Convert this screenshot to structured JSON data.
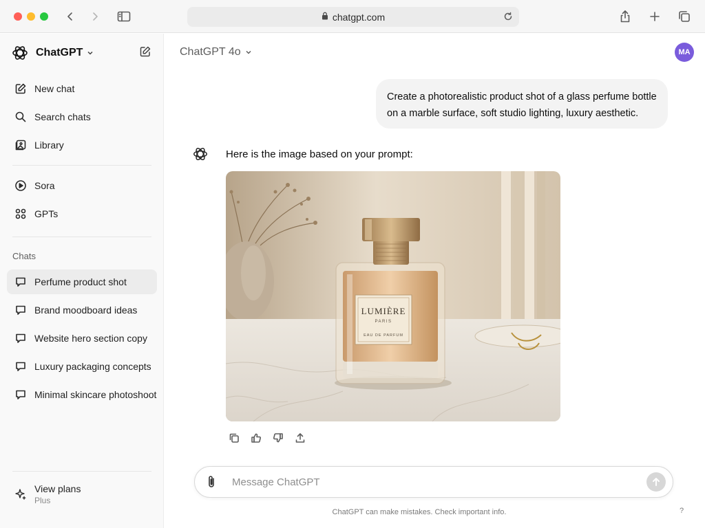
{
  "browser": {
    "url": "chatgpt.com"
  },
  "sidebar": {
    "brand": "ChatGPT",
    "nav": [
      {
        "label": "New chat",
        "icon": "new-chat-icon"
      },
      {
        "label": "Search chats",
        "icon": "search-icon"
      },
      {
        "label": "Library",
        "icon": "library-icon"
      },
      {
        "label": "Sora",
        "icon": "play-icon"
      },
      {
        "label": "GPTs",
        "icon": "grid-icon"
      }
    ],
    "section_title": "Chats",
    "chats": [
      {
        "label": "Perfume product shot",
        "active": true
      },
      {
        "label": "Brand moodboard ideas",
        "active": false
      },
      {
        "label": "Website hero section copy",
        "active": false
      },
      {
        "label": "Luxury packaging concepts",
        "active": false
      },
      {
        "label": "Minimal skincare photoshoot",
        "active": false
      }
    ],
    "plans": {
      "title": "View plans",
      "subtitle": "Plus"
    }
  },
  "header": {
    "model": "ChatGPT 4o",
    "avatar_initials": "MA",
    "avatar_color": "#7a5cdc"
  },
  "conversation": {
    "user_message": "Create a photorealistic product shot of a glass perfume bottle on a marble surface, soft studio lighting, luxury aesthetic.",
    "assistant_message": "Here is the image based on your prompt:",
    "image": {
      "brand": "LUMIÈRE",
      "city": "PARIS",
      "type": "EAU DE PARFUM"
    }
  },
  "composer": {
    "placeholder": "Message ChatGPT"
  },
  "footer": {
    "disclaimer": "ChatGPT can make mistakes. Check important info.",
    "help": "?"
  }
}
